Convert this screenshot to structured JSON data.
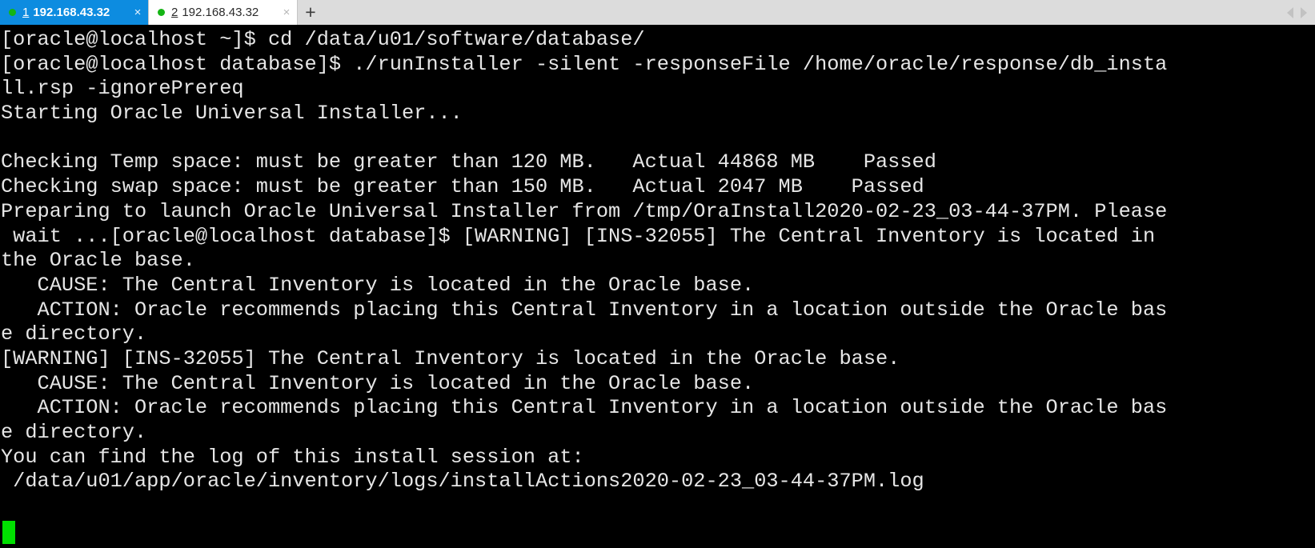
{
  "window": {
    "app": "terminal-emulator"
  },
  "tabbar": {
    "newtab_label": "+",
    "close_label": "×",
    "tabs": [
      {
        "index": "1",
        "title": "192.168.43.32",
        "status_color": "#14b514",
        "active": true
      },
      {
        "index": "2",
        "title": "192.168.43.32",
        "status_color": "#14b514",
        "active": false
      }
    ]
  },
  "terminal": {
    "background": "#000000",
    "foreground": "#e6e6e6",
    "cursor_color": "#00e000",
    "lines": [
      "[oracle@localhost ~]$ cd /data/u01/software/database/",
      "[oracle@localhost database]$ ./runInstaller -silent -responseFile /home/oracle/response/db_insta",
      "ll.rsp -ignorePrereq",
      "Starting Oracle Universal Installer...",
      "",
      "Checking Temp space: must be greater than 120 MB.   Actual 44868 MB    Passed",
      "Checking swap space: must be greater than 150 MB.   Actual 2047 MB    Passed",
      "Preparing to launch Oracle Universal Installer from /tmp/OraInstall2020-02-23_03-44-37PM. Please",
      " wait ...[oracle@localhost database]$ [WARNING] [INS-32055] The Central Inventory is located in",
      "the Oracle base.",
      "   CAUSE: The Central Inventory is located in the Oracle base.",
      "   ACTION: Oracle recommends placing this Central Inventory in a location outside the Oracle bas",
      "e directory.",
      "[WARNING] [INS-32055] The Central Inventory is located in the Oracle base.",
      "   CAUSE: The Central Inventory is located in the Oracle base.",
      "   ACTION: Oracle recommends placing this Central Inventory in a location outside the Oracle bas",
      "e directory.",
      "You can find the log of this install session at:",
      " /data/u01/app/oracle/inventory/logs/installActions2020-02-23_03-44-37PM.log"
    ]
  }
}
